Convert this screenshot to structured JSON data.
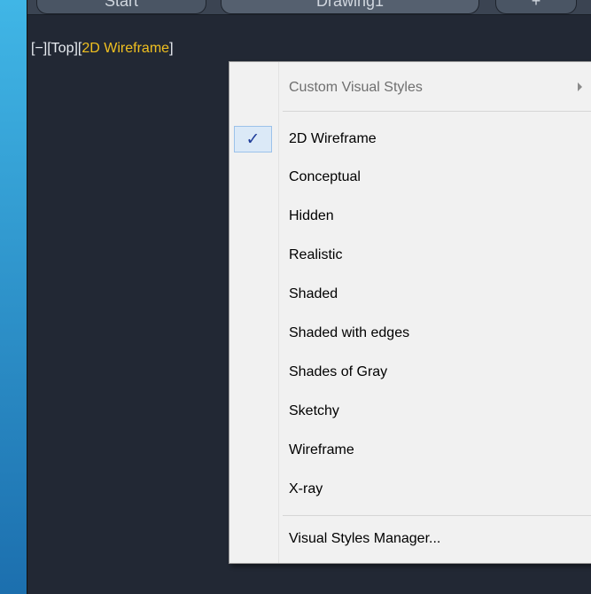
{
  "tabs": {
    "start": "Start",
    "drawing": "Drawing1",
    "new": "+"
  },
  "viewport_label": {
    "minus": "[−]",
    "view": "[Top]",
    "style_open": "[",
    "style": "2D Wireframe",
    "style_close": "]"
  },
  "menu": {
    "custom_styles": "Custom Visual Styles",
    "check_mark": "✓",
    "items": [
      "2D Wireframe",
      "Conceptual",
      "Hidden",
      "Realistic",
      "Shaded",
      "Shaded with edges",
      "Shades of Gray",
      "Sketchy",
      "Wireframe",
      "X-ray"
    ],
    "manager": "Visual Styles Manager..."
  }
}
